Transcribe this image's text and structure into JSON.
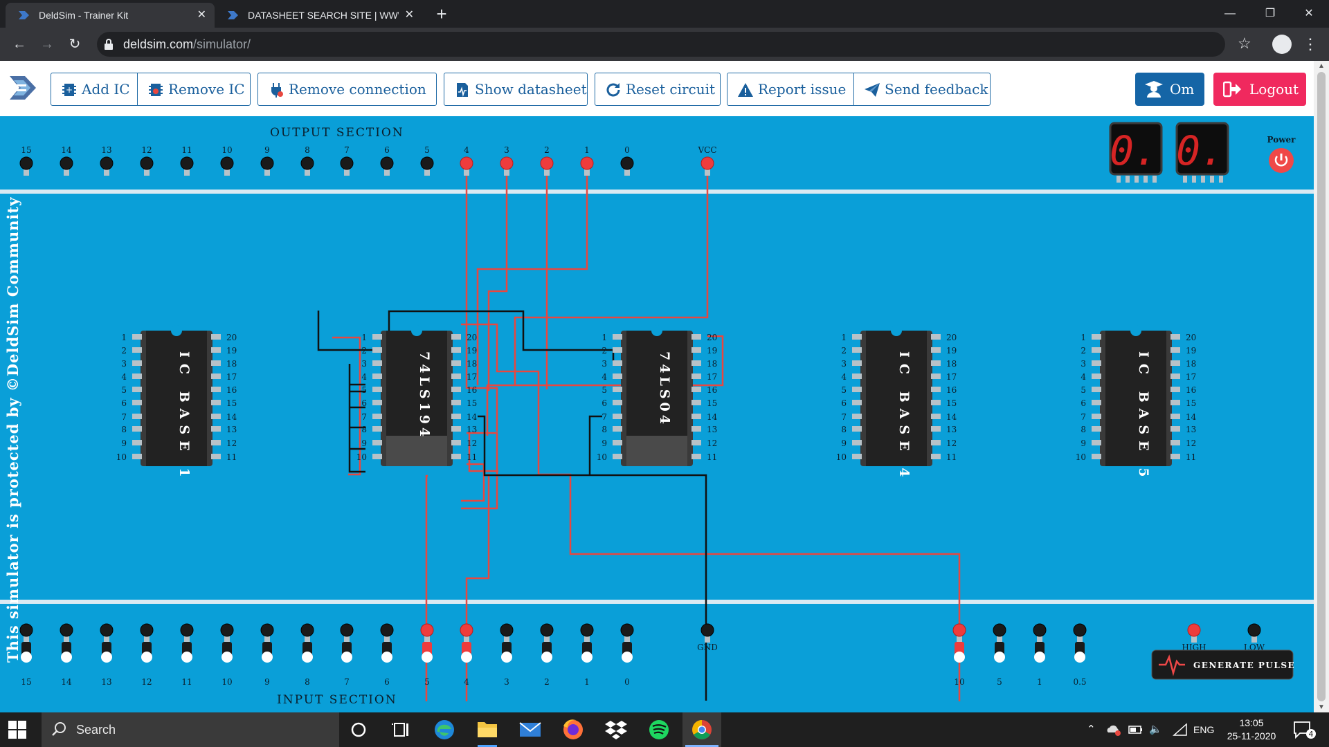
{
  "browser": {
    "tabs": [
      {
        "title": "DeldSim - Trainer Kit",
        "active": true
      },
      {
        "title": "DATASHEET SEARCH SITE | WWW",
        "active": false
      }
    ],
    "url_host": "deldsim.com",
    "url_path": "/simulator/"
  },
  "toolbar": {
    "add_ic": "Add IC",
    "remove_ic": "Remove IC",
    "remove_connection": "Remove connection",
    "show_datasheet": "Show datasheet",
    "reset_circuit": "Reset circuit",
    "report_issue": "Report issue",
    "send_feedback": "Send feedback",
    "user_name": "Om",
    "logout": "Logout"
  },
  "board": {
    "output_section_title": "OUTPUT SECTION",
    "input_section_title": "INPUT SECTION",
    "power_label": "Power",
    "vcc_label": "VCC",
    "gnd_label": "GND",
    "high_label": "HIGH",
    "low_label": "LOW",
    "generate_pulse": "GENERATE PULSE",
    "side_text": "This simulator is protected by ©DeldSim Community",
    "seven_segment_digits": [
      "0.",
      "0."
    ],
    "output_pins": [
      "15",
      "14",
      "13",
      "12",
      "11",
      "10",
      "9",
      "8",
      "7",
      "6",
      "5",
      "4",
      "3",
      "2",
      "1",
      "0"
    ],
    "output_active": [
      "4",
      "3",
      "2",
      "1"
    ],
    "input_pins": [
      "15",
      "14",
      "13",
      "12",
      "11",
      "10",
      "9",
      "8",
      "7",
      "6",
      "5",
      "4",
      "3",
      "2",
      "1",
      "0"
    ],
    "input_active": [
      "5",
      "4"
    ],
    "clock_pins": [
      "10",
      "5",
      "1",
      "0.5"
    ],
    "clock_active": [
      "10"
    ],
    "ic_slots": [
      {
        "label": "IC BASE 1",
        "empty": true
      },
      {
        "label": "74LS194",
        "empty": false
      },
      {
        "label": "74LS04",
        "empty": false
      },
      {
        "label": "IC BASE 4",
        "empty": true
      },
      {
        "label": "IC BASE 5",
        "empty": true
      }
    ],
    "left_pin_numbers": [
      "1",
      "2",
      "3",
      "4",
      "5",
      "6",
      "7",
      "8",
      "9",
      "10"
    ],
    "right_pin_numbers": [
      "20",
      "19",
      "18",
      "17",
      "16",
      "15",
      "14",
      "13",
      "12",
      "11"
    ],
    "colors": {
      "board": "#0a9fd8",
      "wire_red": "#e8473f",
      "wire_black": "#111111",
      "ic_body": "#222222"
    }
  },
  "taskbar": {
    "search_placeholder": "Search",
    "language": "ENG",
    "time": "13:05",
    "date": "25-11-2020",
    "notification_count": "4"
  }
}
